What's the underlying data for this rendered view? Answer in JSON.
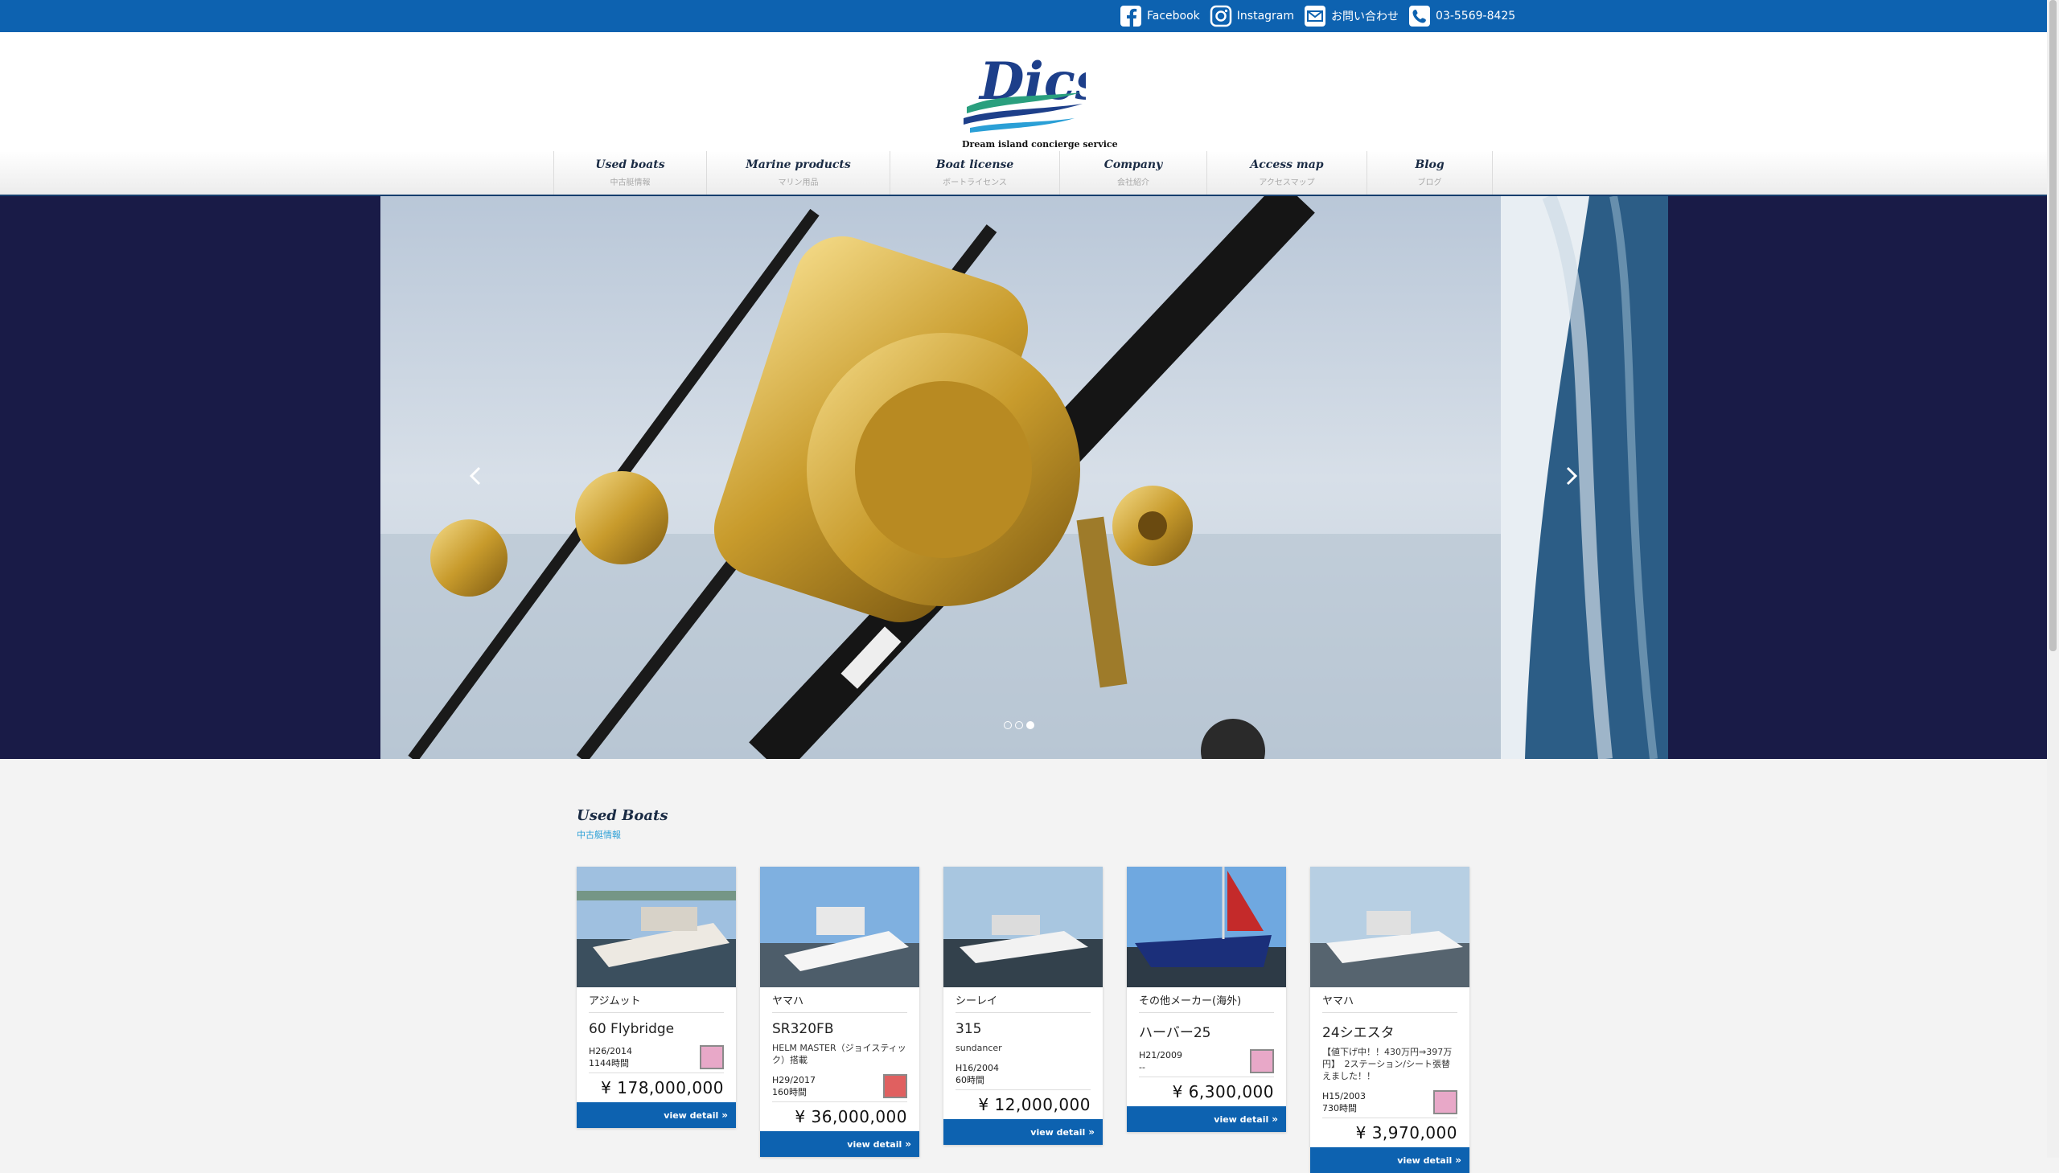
{
  "topbar": {
    "links": [
      {
        "label": "Facebook",
        "icon": "facebook-icon"
      },
      {
        "label": "Instagram",
        "icon": "instagram-icon"
      },
      {
        "label": "お問い合わせ",
        "icon": "mail-icon"
      },
      {
        "label": "03-5569-8425",
        "icon": "phone-icon"
      }
    ]
  },
  "brand": {
    "logo_text": "Dics",
    "tagline": "Dream island concierge service"
  },
  "nav": [
    {
      "en": "Used boats",
      "jp": "中古艇情報"
    },
    {
      "en": "Marine products",
      "jp": "マリン用品"
    },
    {
      "en": "Boat license",
      "jp": "ボートライセンス"
    },
    {
      "en": "Company",
      "jp": "会社紹介"
    },
    {
      "en": "Access map",
      "jp": "アクセスマップ"
    },
    {
      "en": "Blog",
      "jp": "ブログ"
    }
  ],
  "slider": {
    "slides": 3,
    "active_slide": 3,
    "prev_icon": "chevron-left-icon",
    "next_icon": "chevron-right-icon"
  },
  "used_boats": {
    "title": "Used Boats",
    "subtitle": "中古艇情報",
    "button_label": "view detail",
    "cards": [
      {
        "maker": "アジムット",
        "model": "60 Flybridge",
        "desc": "",
        "year": "H26/2014",
        "hours": "1144時間",
        "price": "¥ 178,000,000",
        "badge": true
      },
      {
        "maker": "ヤマハ",
        "model": "SR320FB",
        "desc": "HELM MASTER（ジョイスティック）搭載",
        "year": "H29/2017",
        "hours": "160時間",
        "price": "¥ 36,000,000",
        "badge": true
      },
      {
        "maker": "シーレイ",
        "model": "315",
        "desc": "sundancer",
        "year": "H16/2004",
        "hours": "60時間",
        "price": "¥ 12,000,000",
        "badge": false
      },
      {
        "maker": "その他メーカー(海外)",
        "model": "ハーバー25",
        "desc": "",
        "year": "H21/2009",
        "hours": "--",
        "price": "¥ 6,300,000",
        "badge": true
      },
      {
        "maker": "ヤマハ",
        "model": "24シエスタ",
        "desc": "【値下げ中！！430万円⇒397万円】　2ステーション/シート張替えました！！",
        "year": "H15/2003",
        "hours": "730時間",
        "price": "¥ 3,970,000",
        "badge": true
      }
    ]
  },
  "colors": {
    "topbar": "#0d62b0",
    "hero_bg": "#191b47",
    "nav_text": "#1a2b44",
    "accent": "#2a9fd6"
  }
}
